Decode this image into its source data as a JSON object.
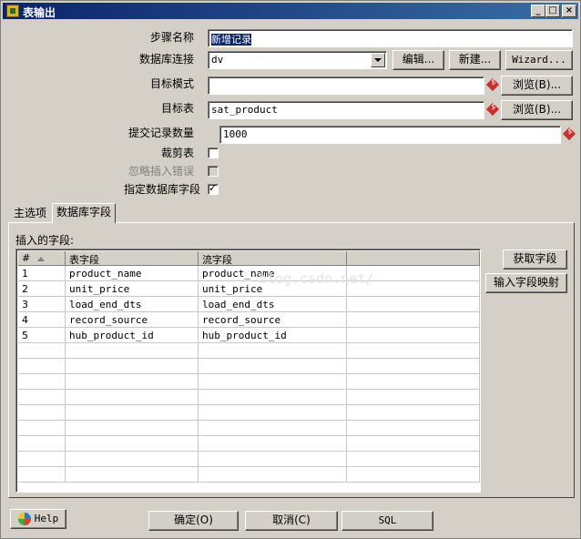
{
  "window": {
    "title": "表输出",
    "controls": {
      "minimize": "_",
      "maximize": "□",
      "close": "×"
    }
  },
  "form": {
    "step_name_label": "步骤名称",
    "step_name_value": "新增记录",
    "connection_label": "数据库连接",
    "connection_value": "dv",
    "edit_button": "编辑...",
    "new_button": "新建...",
    "wizard_button": "Wizard...",
    "target_schema_label": "目标模式",
    "target_schema_value": "",
    "browse_schema_button": "浏览(B)...",
    "target_table_label": "目标表",
    "target_table_value": "sat_product",
    "browse_table_button": "浏览(B)...",
    "commit_size_label": "提交记录数量",
    "commit_size_value": "1000",
    "truncate_label": "裁剪表",
    "ignore_errors_label": "忽略插入错误",
    "specify_fields_label": "指定数据库字段"
  },
  "tabs": {
    "main": "主选项",
    "db_fields": "数据库字段"
  },
  "fields_panel": {
    "insert_label": "插入的字段:",
    "columns": [
      "#",
      "表字段",
      "流字段"
    ],
    "rows": [
      {
        "n": "1",
        "table": "product_name",
        "stream": "product_name"
      },
      {
        "n": "2",
        "table": "unit_price",
        "stream": "unit_price"
      },
      {
        "n": "3",
        "table": "load_end_dts",
        "stream": "load_end_dts"
      },
      {
        "n": "4",
        "table": "record_source",
        "stream": "record_source"
      },
      {
        "n": "5",
        "table": "hub_product_id",
        "stream": "hub_product_id"
      }
    ],
    "get_fields_button": "获取字段",
    "map_fields_button": "输入字段映射",
    "watermark": "blog.csdn.net/"
  },
  "footer": {
    "help": "Help",
    "ok": "确定(O)",
    "cancel": "取消(C)",
    "sql": "SQL"
  }
}
